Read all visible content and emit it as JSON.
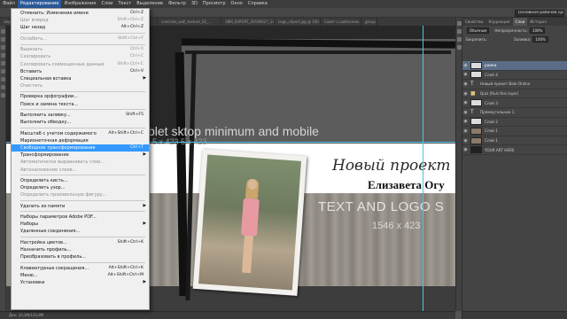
{
  "menubar": {
    "items": [
      "Файл",
      "Редактирование",
      "Изображение",
      "Слои",
      "Текст",
      "Выделение",
      "Фильтр",
      "3D",
      "Просмотр",
      "Окно",
      "Справка"
    ],
    "active_index": 1
  },
  "options_bar": {
    "workspace": "Основная рабочая среда"
  },
  "tabs": [
    "obys... 400 @ 100% (рамка, RGB/8)",
    "concrete_wall_texture_02_...",
    "1BM_EXPORT_20180627_143...",
    "Logo_clipart.jpg @ 100...",
    "Совет с шаблоном...",
    "group..."
  ],
  "edit_menu": {
    "groups": [
      [
        {
          "label": "Отменить: Изменение имени",
          "shortcut": "Ctrl+Z",
          "disabled": false
        },
        {
          "label": "Шаг вперед",
          "shortcut": "Shift+Ctrl+Z",
          "disabled": true
        },
        {
          "label": "Шаг назад",
          "shortcut": "Alt+Ctrl+Z",
          "disabled": false
        }
      ],
      [
        {
          "label": "Ослабить...",
          "shortcut": "Shift+Ctrl+F",
          "disabled": true
        }
      ],
      [
        {
          "label": "Вырезать",
          "shortcut": "Ctrl+X",
          "disabled": true
        },
        {
          "label": "Скопировать",
          "shortcut": "Ctrl+C",
          "disabled": true
        },
        {
          "label": "Скопировать совмещенные данные",
          "shortcut": "Shift+Ctrl+C",
          "disabled": true
        },
        {
          "label": "Вставить",
          "shortcut": "Ctrl+V",
          "disabled": false
        },
        {
          "label": "Специальная вставка",
          "submenu": true,
          "disabled": false
        },
        {
          "label": "Очистить",
          "disabled": true
        }
      ],
      [
        {
          "label": "Проверка орфографии...",
          "disabled": false
        },
        {
          "label": "Поиск и замена текста...",
          "disabled": false
        }
      ],
      [
        {
          "label": "Выполнить заливку...",
          "shortcut": "Shift+F5",
          "disabled": false
        },
        {
          "label": "Выполнить обводку...",
          "disabled": false
        }
      ],
      [
        {
          "label": "Масштаб с учетом содержимого",
          "shortcut": "Alt+Shift+Ctrl+C",
          "disabled": false
        },
        {
          "label": "Марионеточная деформация",
          "disabled": false
        },
        {
          "label": "Свободное трансформирование",
          "shortcut": "Ctrl+T",
          "highlighted": true,
          "disabled": false
        },
        {
          "label": "Трансформирование",
          "submenu": true,
          "disabled": false
        },
        {
          "label": "Автоматически выравнивать слои...",
          "disabled": true
        },
        {
          "label": "Автоналожение слоев...",
          "disabled": true
        }
      ],
      [
        {
          "label": "Определить кисть...",
          "disabled": false
        },
        {
          "label": "Определить узор...",
          "disabled": false
        },
        {
          "label": "Определить произвольную фигуру...",
          "disabled": true
        }
      ],
      [
        {
          "label": "Удалить из памяти",
          "submenu": true,
          "disabled": false
        }
      ],
      [
        {
          "label": "Наборы параметров Adobe PDF...",
          "disabled": false
        },
        {
          "label": "Наборы",
          "submenu": true,
          "disabled": false
        },
        {
          "label": "Удаленные соединения...",
          "disabled": false
        }
      ],
      [
        {
          "label": "Настройка цветов...",
          "shortcut": "Shift+Ctrl+K",
          "disabled": false
        },
        {
          "label": "Назначить профиль...",
          "disabled": false
        },
        {
          "label": "Преобразовать в профиль...",
          "disabled": false
        }
      ],
      [
        {
          "label": "Клавиатурные сокращения...",
          "shortcut": "Alt+Shift+Ctrl+K",
          "disabled": false
        },
        {
          "label": "Меню...",
          "shortcut": "Alt+Shift+Ctrl+M",
          "disabled": false
        },
        {
          "label": "Установки",
          "submenu": true,
          "disabled": false
        }
      ]
    ]
  },
  "canvas": {
    "overlay_text": "blet  sktop minimum and mobile",
    "overlay_dims": "5 x 423   5 x 423",
    "script_title": "Новый проект Ba",
    "name_title": "Елизавета Огу",
    "logo_text": "TEXT AND LOGO S",
    "logo_dims": "1546 x 423"
  },
  "status": "Док: 10,3M/120,8M",
  "panel": {
    "top_tabs": [
      "Свойства",
      "Коррекция",
      "Слои",
      "История"
    ],
    "kind_label": "Обычные",
    "opacity_label": "Непрозрачность:",
    "opacity_value": "100%",
    "lock_label": "Закрепить:",
    "fill_label": "Заливка:",
    "fill_value": "100%",
    "layers": [
      {
        "name": "рамка",
        "selected": true,
        "thumb": "light"
      },
      {
        "name": "Слой 4",
        "thumb": "light"
      },
      {
        "name": "Новый проект Bale Online",
        "thumb": "text"
      },
      {
        "name": "Quiz (fiuls this layer)",
        "thumb": "folder"
      },
      {
        "name": "Слой 3",
        "thumb": "light"
      },
      {
        "name": "Прямоугольник 1",
        "thumb": "text"
      },
      {
        "name": "Слой 2",
        "thumb": "light"
      },
      {
        "name": "Слой 1",
        "thumb": "brown"
      },
      {
        "name": "Слой 1",
        "thumb": "brown"
      },
      {
        "name": "YOUR ART HERE",
        "thumb": "dark"
      }
    ]
  }
}
